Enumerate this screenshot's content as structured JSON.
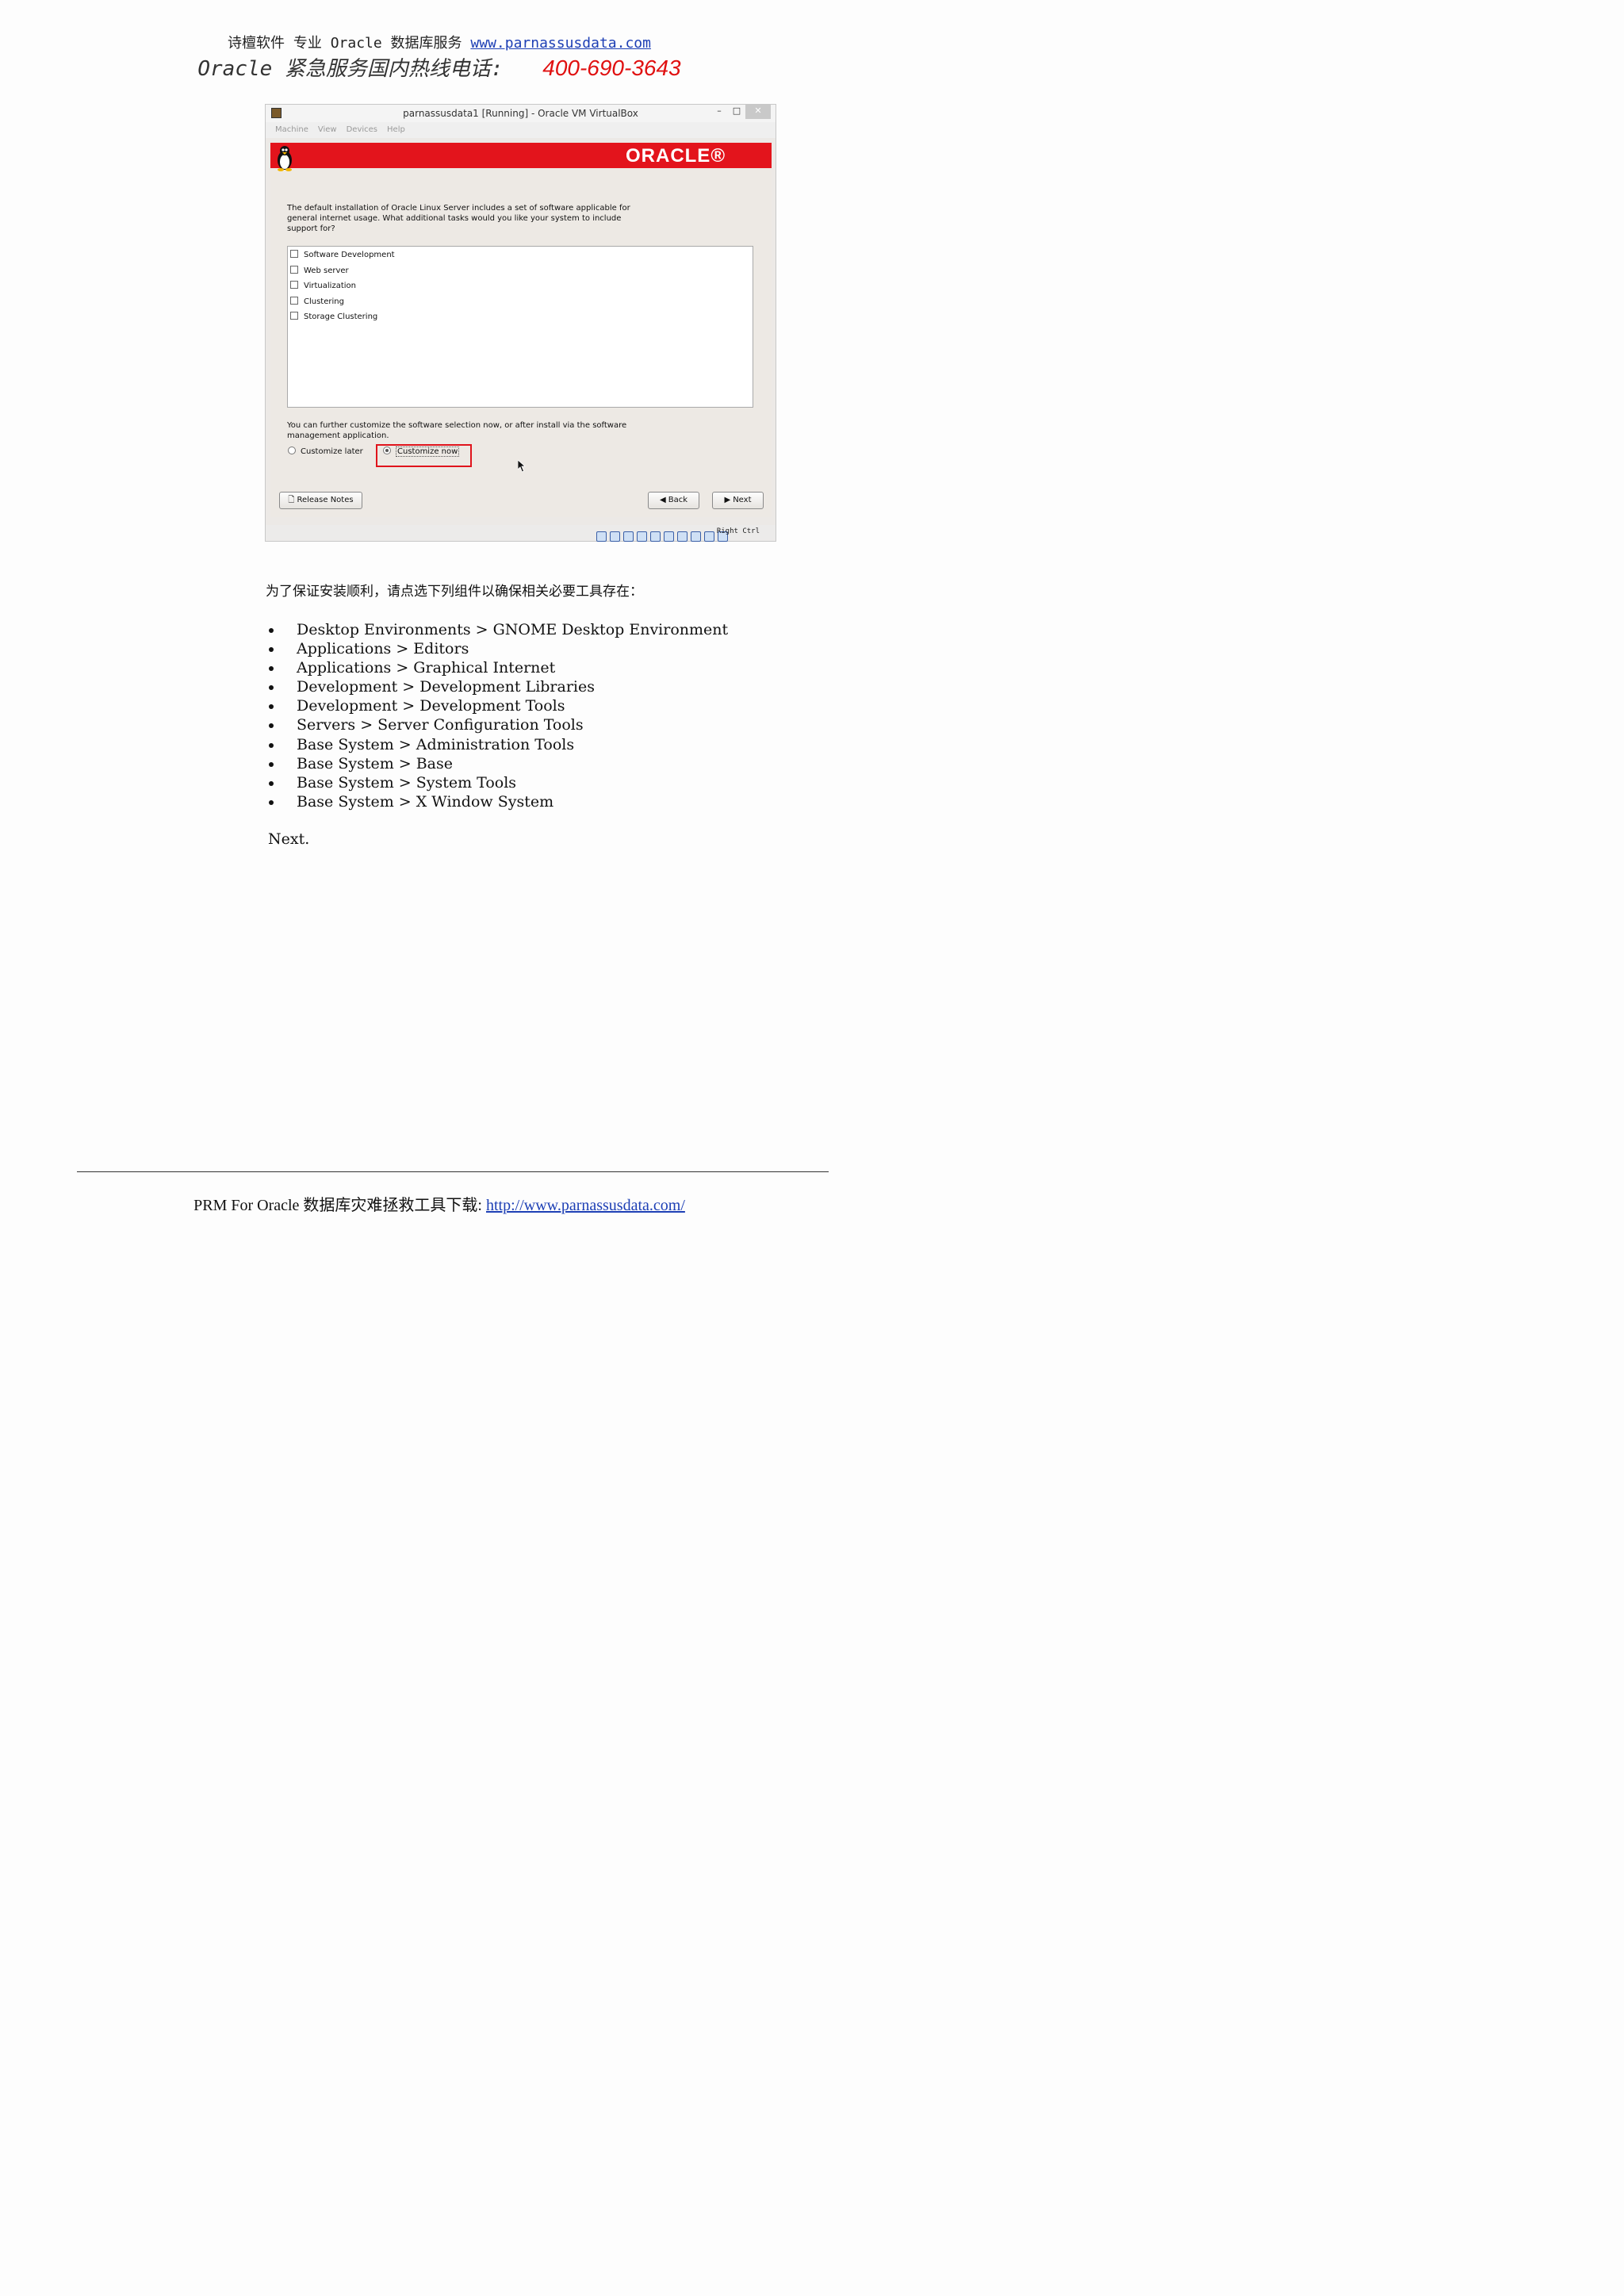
{
  "header": {
    "line1_text": "诗檀软件 专业 Oracle 数据库服务 ",
    "line1_link": "www.parnassusdata.com",
    "line2_text": "Oracle 紧急服务国内热线电话: ",
    "phone": "400-690-3643"
  },
  "vbox": {
    "title": "parnassusdata1 [Running] - Oracle VM VirtualBox",
    "close_glyph": "✕",
    "menu": [
      "Machine",
      "View",
      "Devices",
      "Help"
    ],
    "oracle_logo": "ORACLE®",
    "intro": "The default installation of Oracle Linux Server includes a set of software applicable for general internet usage. What additional tasks would you like your system to include support for?",
    "tasks": [
      {
        "label": "Software Development",
        "checked": false
      },
      {
        "label": "Web server",
        "checked": false
      },
      {
        "label": "Virtualization",
        "checked": false
      },
      {
        "label": "Clustering",
        "checked": false
      },
      {
        "label": "Storage Clustering",
        "checked": false
      }
    ],
    "further": "You can further customize the software selection now, or after install via the software management application.",
    "radio_later": "Customize later",
    "radio_now": "Customize now",
    "selected_radio": "Customize now",
    "btn_release": "Release Notes",
    "btn_back": "Back",
    "btn_next": "Next",
    "right_ctrl": "Right Ctrl",
    "status_icons": [
      "disk-icon",
      "cd-icon",
      "usb-icon",
      "network-icon",
      "shared-folder-icon",
      "display-icon",
      "vrde-icon",
      "capture-icon",
      "mouse-integration-icon",
      "keyboard-icon"
    ]
  },
  "body": {
    "intro_zh": "为了保证安装顺利，请点选下列组件以确保相关必要工具存在：",
    "items": [
      "Desktop Environments > GNOME Desktop Environment",
      "Applications > Editors",
      "Applications > Graphical Internet",
      "Development > Development Libraries",
      "Development > Development Tools",
      "Servers > Server Configuration Tools",
      "Base System > Administration Tools",
      "Base System > Base",
      "Base System > System Tools",
      "Base System > X Window System"
    ],
    "next": "Next."
  },
  "footer": {
    "text": "PRM For Oracle 数据库灾难拯救工具下载: ",
    "link": "http://www.parnassusdata.com/"
  },
  "colors": {
    "oracle_red": "#e3141c",
    "phone_red": "#e01010",
    "link_blue": "#1d3fb5",
    "highlight_red": "#e0141c"
  }
}
